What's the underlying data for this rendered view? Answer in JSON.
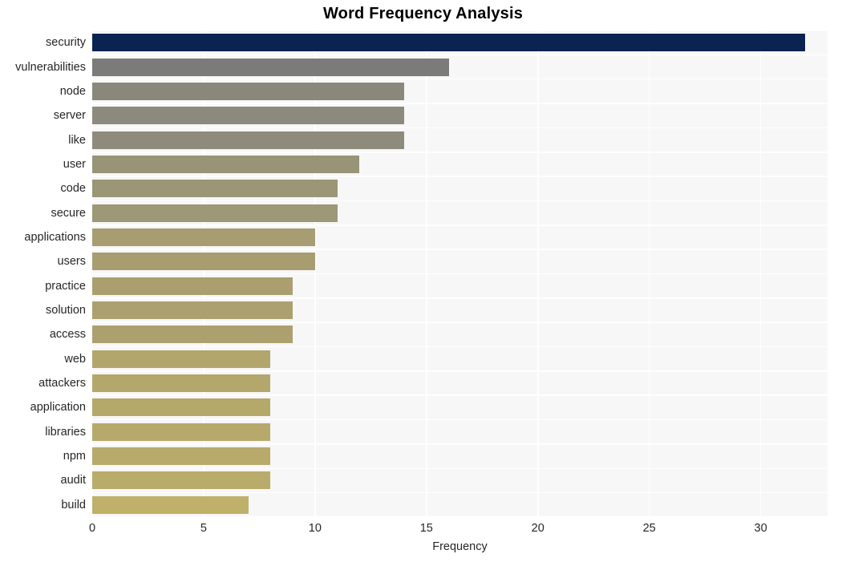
{
  "chart_data": {
    "type": "bar",
    "orientation": "horizontal",
    "title": "Word Frequency Analysis",
    "xlabel": "Frequency",
    "ylabel": "",
    "xlim": [
      0,
      33
    ],
    "ylim": null,
    "grid": true,
    "legend": false,
    "legend_position": "none",
    "xticks": [
      0,
      5,
      10,
      15,
      20,
      25,
      30
    ],
    "xtick_labels": [
      "0",
      "5",
      "10",
      "15",
      "20",
      "25",
      "30"
    ],
    "categories": [
      "security",
      "vulnerabilities",
      "node",
      "server",
      "like",
      "user",
      "code",
      "secure",
      "applications",
      "users",
      "practice",
      "solution",
      "access",
      "web",
      "attackers",
      "application",
      "libraries",
      "npm",
      "audit",
      "build"
    ],
    "values": [
      32,
      16,
      14,
      14,
      14,
      12,
      11,
      11,
      10,
      10,
      9,
      9,
      9,
      8,
      8,
      8,
      8,
      8,
      8,
      7
    ],
    "bar_colors": [
      "#0b2350",
      "#7b7b79",
      "#8a887a",
      "#8c8a7c",
      "#8e8b7c",
      "#999377",
      "#9b9676",
      "#9d9875",
      "#a79c72",
      "#a89d71",
      "#ab9f70",
      "#ac9f70",
      "#ada06f",
      "#b3a66c",
      "#b4a76c",
      "#b5a86b",
      "#b6a96b",
      "#b7aa6a",
      "#b9ab6a",
      "#bfb169"
    ]
  },
  "style": {
    "plot_background": "#f7f7f7",
    "figure_background": "#ffffff",
    "gridline_color": "#ffffff",
    "text_color": "#262626",
    "title_color": "#000000",
    "highlight_color": "#0b2350"
  }
}
